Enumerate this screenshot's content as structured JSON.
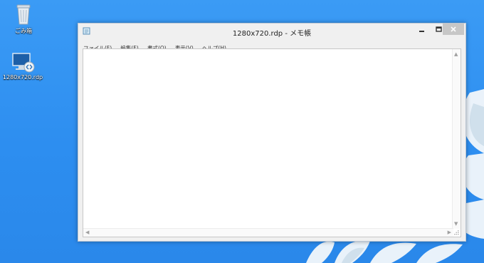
{
  "desktop": {
    "icons": [
      {
        "label": "ごみ箱",
        "icon": "recycle-bin-icon"
      },
      {
        "label": "1280x720.rdp",
        "icon": "remote-desktop-icon"
      }
    ]
  },
  "window": {
    "title": "1280x720.rdp - メモ帳",
    "app_icon": "notepad-icon",
    "controls": {
      "minimize": "minimize-icon",
      "maximize": "maximize-icon",
      "close": "close-icon"
    },
    "menu": [
      "ファイル(F)",
      "編集(E)",
      "書式(O)",
      "表示(V)",
      "ヘルプ(H)"
    ],
    "text_content": ""
  },
  "colors": {
    "desktop": "#2f8ff0",
    "window_frame": "#f0f0f0",
    "close_button": "#c7c7c7"
  }
}
